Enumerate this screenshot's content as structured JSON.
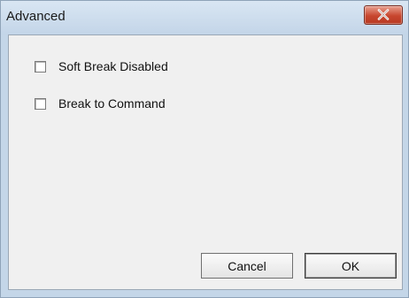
{
  "window": {
    "title": "Advanced"
  },
  "options": [
    {
      "label": "Soft Break Disabled",
      "checked": false
    },
    {
      "label": "Break to Command",
      "checked": false
    }
  ],
  "buttons": {
    "cancel_label": "Cancel",
    "ok_label": "OK"
  },
  "icons": {
    "close": "close-icon"
  },
  "colors": {
    "close_button": "#c7462e",
    "titlebar": "#c3d5e8",
    "client_bg": "#f0f0f0"
  }
}
